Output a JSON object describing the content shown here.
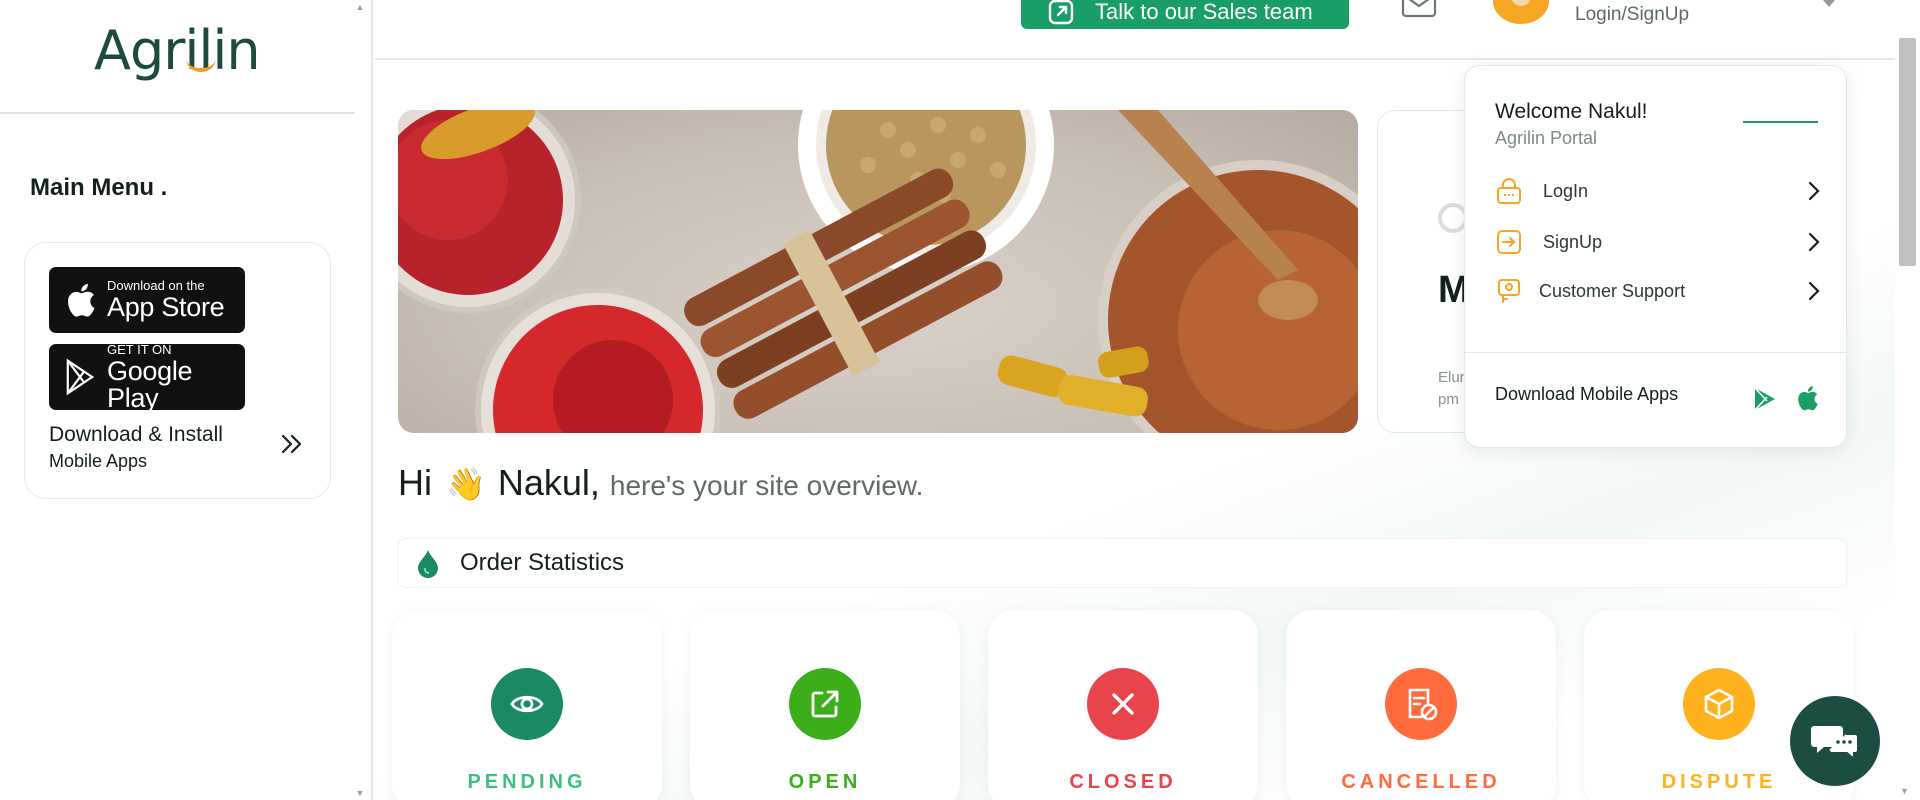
{
  "sidebar": {
    "logo_text": "Agrilin",
    "main_menu": "Main Menu .",
    "apps": {
      "apple_small": "Download on the",
      "apple_big": "App Store",
      "google_small": "GET IT ON",
      "google_big": "Google Play",
      "install_title": "Download & Install",
      "install_sub": "Mobile Apps"
    }
  },
  "header": {
    "sales_button": "Talk to our Sales team",
    "login_signup": "Login/SignUp"
  },
  "side_card": {
    "title_initial": "M",
    "line1": "Elur",
    "line2": "pm"
  },
  "greeting": {
    "hi": "Hi",
    "wave": "👋",
    "name": "Nakul,",
    "sub": "here's your site overview."
  },
  "stats": {
    "title": "Order Statistics",
    "cards": [
      {
        "label": "PENDING",
        "color": "#1a8a64",
        "text_color": "#3fbf7f",
        "icon": "eye-icon"
      },
      {
        "label": "OPEN",
        "color": "#3cae1a",
        "text_color": "#3cae1a",
        "icon": "external-link-icon"
      },
      {
        "label": "CLOSED",
        "color": "#e8444c",
        "text_color": "#e8444c",
        "icon": "close-icon"
      },
      {
        "label": "CANCELLED",
        "color": "#ff6b3d",
        "text_color": "#ff6b3d",
        "icon": "cancelled-doc-icon"
      },
      {
        "label": "DISPUTE",
        "color": "#ffb21e",
        "text_color": "#ffb21e",
        "icon": "box-icon"
      }
    ]
  },
  "dropdown": {
    "welcome": "Welcome Nakul!",
    "portal": "Agrilin Portal",
    "items": [
      {
        "label": "LogIn",
        "icon": "lock-icon"
      },
      {
        "label": "SignUp",
        "icon": "signup-icon"
      },
      {
        "label": "Customer Support",
        "icon": "support-icon"
      }
    ],
    "download": "Download Mobile Apps"
  },
  "colors": {
    "brand_green": "#1a9e68",
    "dark_green": "#1b4d43",
    "accent_orange": "#f0a020"
  }
}
